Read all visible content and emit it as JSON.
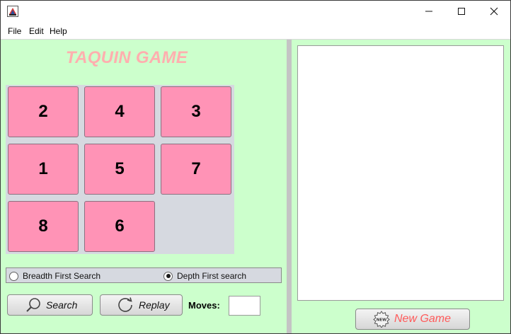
{
  "titlebar": {
    "app_icon": "java-app-icon",
    "minimize_icon": "minimize-icon",
    "maximize_icon": "maximize-icon",
    "close_icon": "close-icon"
  },
  "menu": {
    "file": "File",
    "edit": "Edit",
    "help": "Help"
  },
  "game": {
    "title": "TAQUIN GAME",
    "tiles": [
      "2",
      "4",
      "3",
      "1",
      "5",
      "7",
      "8",
      "6",
      ""
    ],
    "colors": {
      "panel_bg": "#ccffcc",
      "board_bg": "#d6d9e0",
      "tile_bg": "#ff93b6",
      "title_color": "#ffafaf",
      "new_game_text": "#ff5a5a"
    }
  },
  "search_options": {
    "bfs_label": "Breadth First Search",
    "dfs_label": "Depth First search",
    "selected": "dfs"
  },
  "controls": {
    "search_label": "Search",
    "search_icon": "magnifier-icon",
    "replay_label": "Replay",
    "replay_icon": "refresh-icon",
    "moves_label": "Moves:",
    "moves_value": ""
  },
  "right": {
    "log_text": "",
    "new_game_label": "New Game",
    "new_game_icon": "new-badge-icon"
  }
}
